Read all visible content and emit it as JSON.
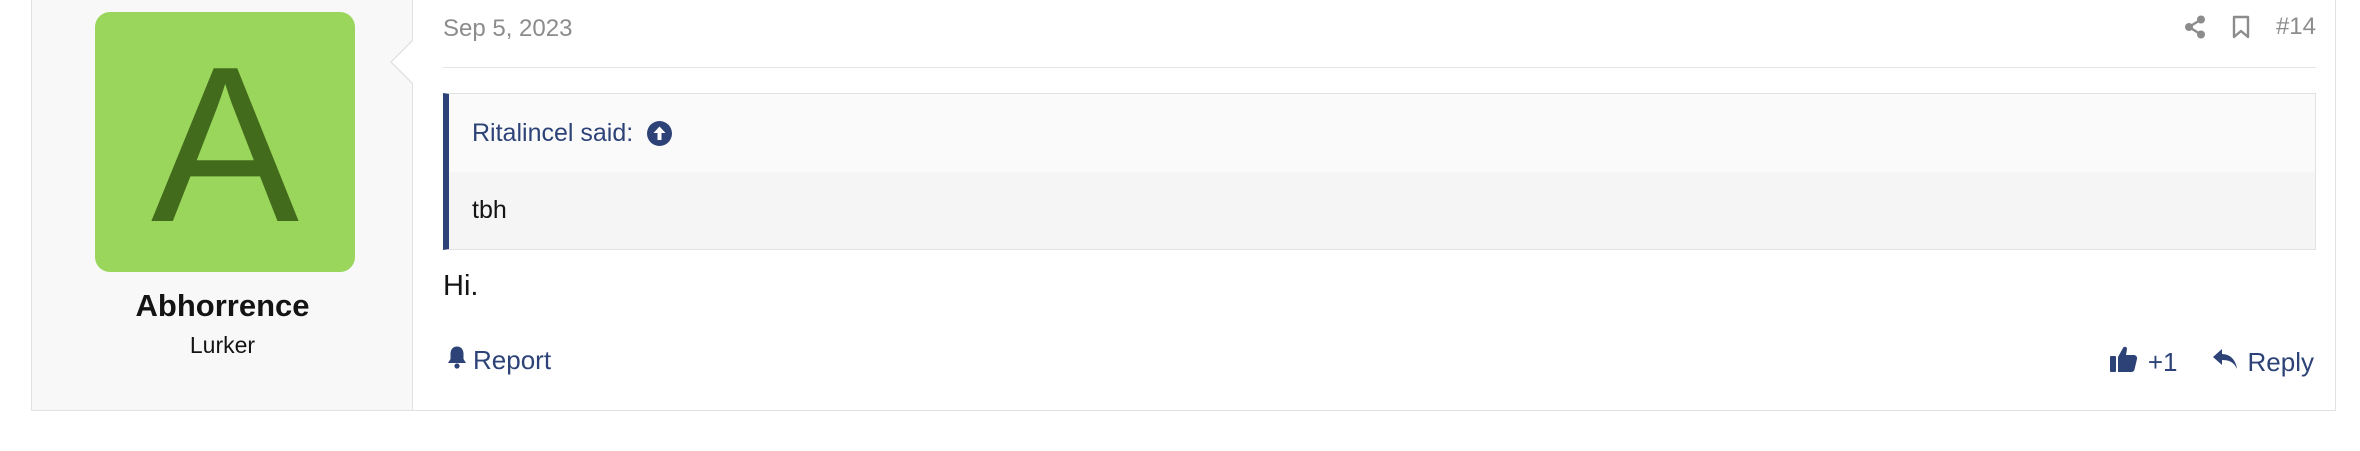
{
  "author": {
    "avatar_letter": "A",
    "avatar_color": "#9ad65c",
    "name": "Abhorrence",
    "title": "Lurker"
  },
  "post": {
    "date": "Sep 5, 2023",
    "number": "#14",
    "quote": {
      "author_line": "Ritalincel said:",
      "text": "tbh"
    },
    "message": "Hi."
  },
  "actions": {
    "share_icon": "share-icon",
    "bookmark_icon": "bookmark-icon",
    "report_label": "Report",
    "like_label": "+1",
    "reply_label": "Reply"
  },
  "colors": {
    "link": "#2d4378",
    "muted": "#8c8c8c"
  }
}
